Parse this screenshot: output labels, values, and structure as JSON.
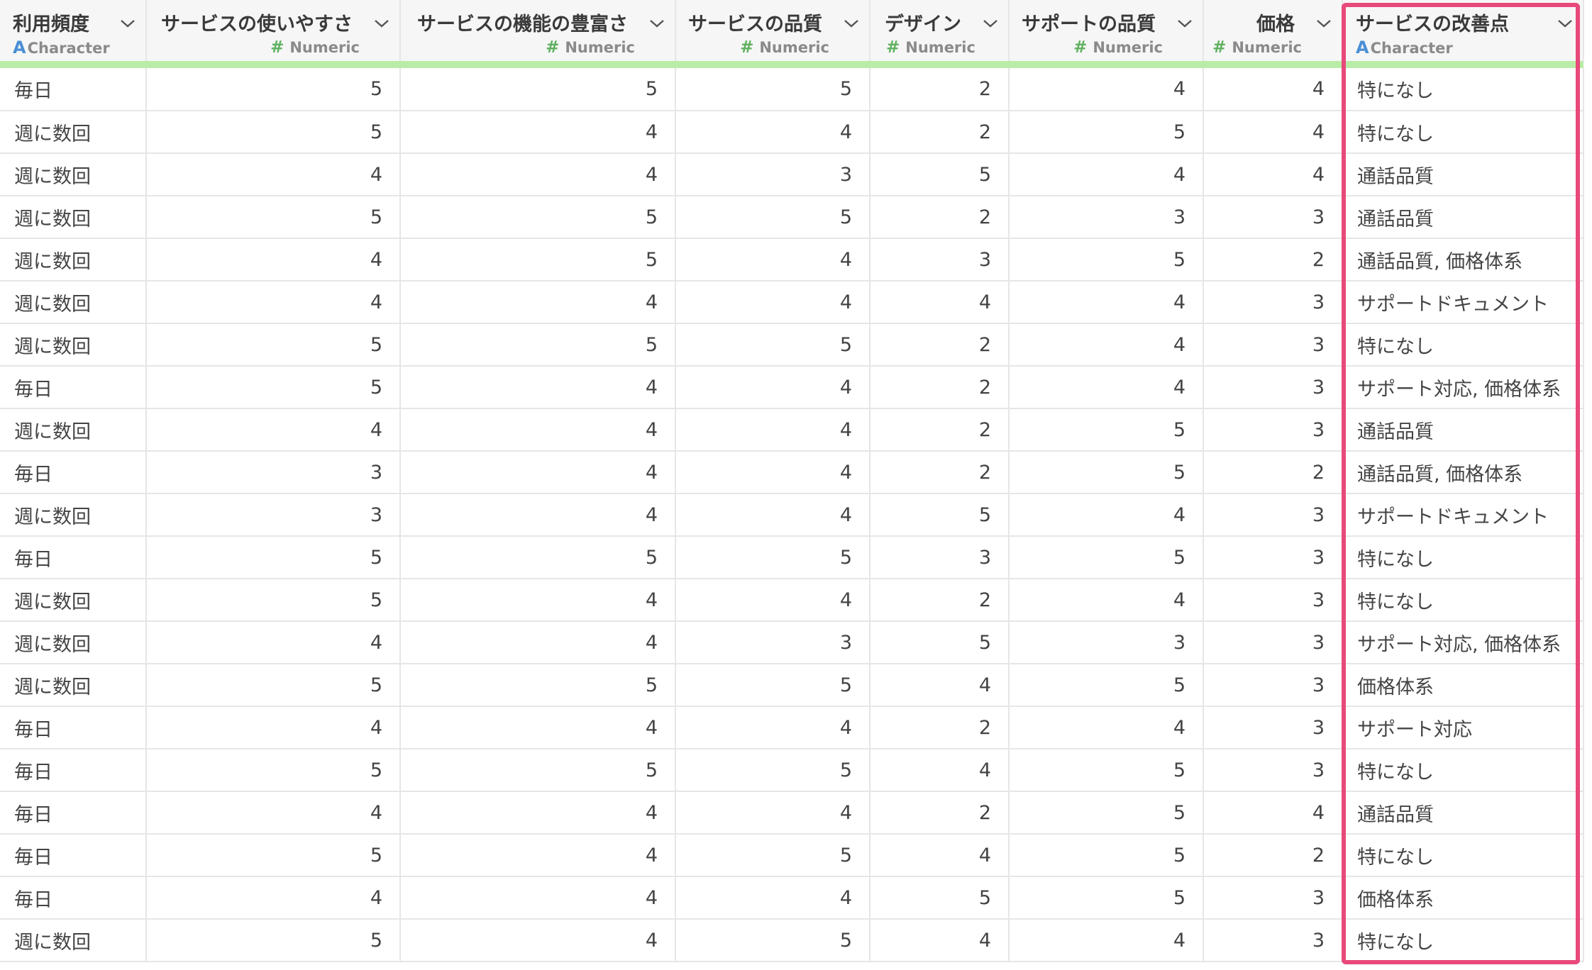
{
  "columns": [
    {
      "name": "利用頻度",
      "type": "Character",
      "align": "left"
    },
    {
      "name": "サービスの使いやすさ",
      "type": "Numeric",
      "align": "right"
    },
    {
      "name": "サービスの機能の豊富さ",
      "type": "Numeric",
      "align": "right"
    },
    {
      "name": "サービスの品質",
      "type": "Numeric",
      "align": "right"
    },
    {
      "name": "デザイン",
      "type": "Numeric",
      "align": "right"
    },
    {
      "name": "サポートの品質",
      "type": "Numeric",
      "align": "right"
    },
    {
      "name": "価格",
      "type": "Numeric",
      "align": "right"
    },
    {
      "name": "サービスの改善点",
      "type": "Character",
      "align": "left"
    }
  ],
  "rows": [
    [
      "毎日",
      "5",
      "5",
      "5",
      "2",
      "4",
      "4",
      "特になし"
    ],
    [
      "週に数回",
      "5",
      "4",
      "4",
      "2",
      "5",
      "4",
      "特になし"
    ],
    [
      "週に数回",
      "4",
      "4",
      "3",
      "5",
      "4",
      "4",
      "通話品質"
    ],
    [
      "週に数回",
      "5",
      "5",
      "5",
      "2",
      "3",
      "3",
      "通話品質"
    ],
    [
      "週に数回",
      "4",
      "5",
      "4",
      "3",
      "5",
      "2",
      "通話品質, 価格体系"
    ],
    [
      "週に数回",
      "4",
      "4",
      "4",
      "4",
      "4",
      "3",
      "サポートドキュメント"
    ],
    [
      "週に数回",
      "5",
      "5",
      "5",
      "2",
      "4",
      "3",
      "特になし"
    ],
    [
      "毎日",
      "5",
      "4",
      "4",
      "2",
      "4",
      "3",
      "サポート対応, 価格体系"
    ],
    [
      "週に数回",
      "4",
      "4",
      "4",
      "2",
      "5",
      "3",
      "通話品質"
    ],
    [
      "毎日",
      "3",
      "4",
      "4",
      "2",
      "5",
      "2",
      "通話品質, 価格体系"
    ],
    [
      "週に数回",
      "3",
      "4",
      "4",
      "5",
      "4",
      "3",
      "サポートドキュメント"
    ],
    [
      "毎日",
      "5",
      "5",
      "5",
      "3",
      "5",
      "3",
      "特になし"
    ],
    [
      "週に数回",
      "5",
      "4",
      "4",
      "2",
      "4",
      "3",
      "特になし"
    ],
    [
      "週に数回",
      "4",
      "4",
      "3",
      "5",
      "3",
      "3",
      "サポート対応, 価格体系"
    ],
    [
      "週に数回",
      "5",
      "5",
      "5",
      "4",
      "5",
      "3",
      "価格体系"
    ],
    [
      "毎日",
      "4",
      "4",
      "4",
      "2",
      "4",
      "3",
      "サポート対応"
    ],
    [
      "毎日",
      "5",
      "5",
      "5",
      "4",
      "5",
      "3",
      "特になし"
    ],
    [
      "毎日",
      "4",
      "4",
      "4",
      "2",
      "5",
      "4",
      "通話品質"
    ],
    [
      "毎日",
      "5",
      "4",
      "5",
      "4",
      "5",
      "2",
      "特になし"
    ],
    [
      "毎日",
      "4",
      "4",
      "4",
      "5",
      "5",
      "3",
      "価格体系"
    ],
    [
      "週に数回",
      "5",
      "4",
      "5",
      "4",
      "4",
      "3",
      "特になし"
    ]
  ],
  "highlight_color": "#e8497a",
  "quality_bar_color": "#b9eca6",
  "icons": {
    "character_type": "letter-a-icon",
    "numeric_type": "hash-icon",
    "column_menu": "chevron-down-icon"
  }
}
